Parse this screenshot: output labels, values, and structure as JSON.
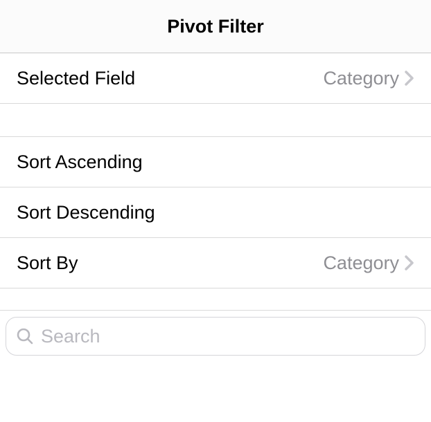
{
  "header": {
    "title": "Pivot Filter"
  },
  "selectedField": {
    "label": "Selected Field",
    "value": "Category"
  },
  "sort": {
    "ascendingLabel": "Sort Ascending",
    "descendingLabel": "Sort Descending",
    "byLabel": "Sort By",
    "byValue": "Category"
  },
  "search": {
    "placeholder": "Search",
    "value": ""
  }
}
